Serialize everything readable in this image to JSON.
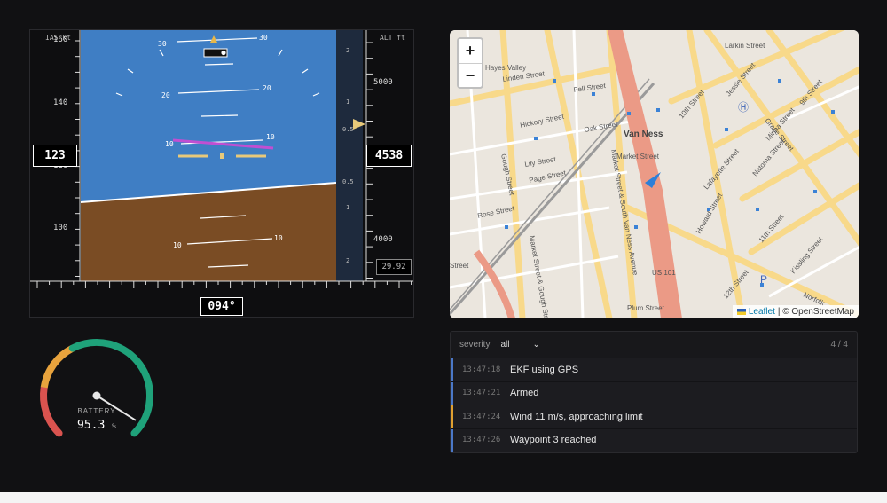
{
  "pfd": {
    "ias_label": "IAS kt",
    "alt_label": "ALT ft",
    "speed_ticks": [
      "160",
      "140",
      "120",
      "100"
    ],
    "airspeed": "123",
    "altitude": "4538",
    "alt_ticks": [
      "5000",
      "4000"
    ],
    "vs_ticks": [
      "2",
      "1",
      "0.5",
      "0.5",
      "1",
      "2"
    ],
    "pitch_labels": [
      "30",
      "20",
      "10",
      "10"
    ],
    "baro": "29.92",
    "heading": "094°",
    "colors": {
      "sky": "#3f7ec4",
      "ground": "#7a4c24",
      "flight_director": "#c04fd2",
      "aircraft_symbol": "#e8c97a"
    }
  },
  "map": {
    "zoom_in": "+",
    "zoom_out": "−",
    "street_labels": [
      "Hayes Valley",
      "Linden Street",
      "Fell Street",
      "Hickory Street",
      "Oak Street",
      "Gough Street",
      "Lily Street",
      "Page Street",
      "Rose Street",
      "Van Ness",
      "Market Street & South Van Ness Avenue",
      "Market Street & Gough Street",
      "Market Street",
      "10th Street",
      "9th Street",
      "Jessie Street",
      "Minna Street",
      "Natoma Street",
      "Howard Street",
      "Lafayette Street",
      "11th Street",
      "12th Street",
      "Kissling Street",
      "US 101",
      "Plum Street",
      "Grace Street",
      "Norfolk",
      "Larkin Street",
      "Street"
    ],
    "attribution_leaflet": "Leaflet",
    "attribution_osm": "| © OpenStreetMap"
  },
  "gauge": {
    "label": "BATTERY",
    "value": "95.3",
    "unit": "%",
    "level_percent": 95.3,
    "colors": {
      "low": "#d9534f",
      "mid": "#e8a33d",
      "high": "#1fa27a"
    }
  },
  "log": {
    "filter_label": "severity",
    "filter_value": "all",
    "count": "4 / 4",
    "entries": [
      {
        "time": "13:47:18",
        "message": "EKF using GPS",
        "color": "#4b78c8"
      },
      {
        "time": "13:47:21",
        "message": "Armed",
        "color": "#4b78c8"
      },
      {
        "time": "13:47:24",
        "message": "Wind 11 m/s, approaching limit",
        "color": "#e0a030"
      },
      {
        "time": "13:47:26",
        "message": "Waypoint 3 reached",
        "color": "#4b78c8"
      }
    ]
  }
}
